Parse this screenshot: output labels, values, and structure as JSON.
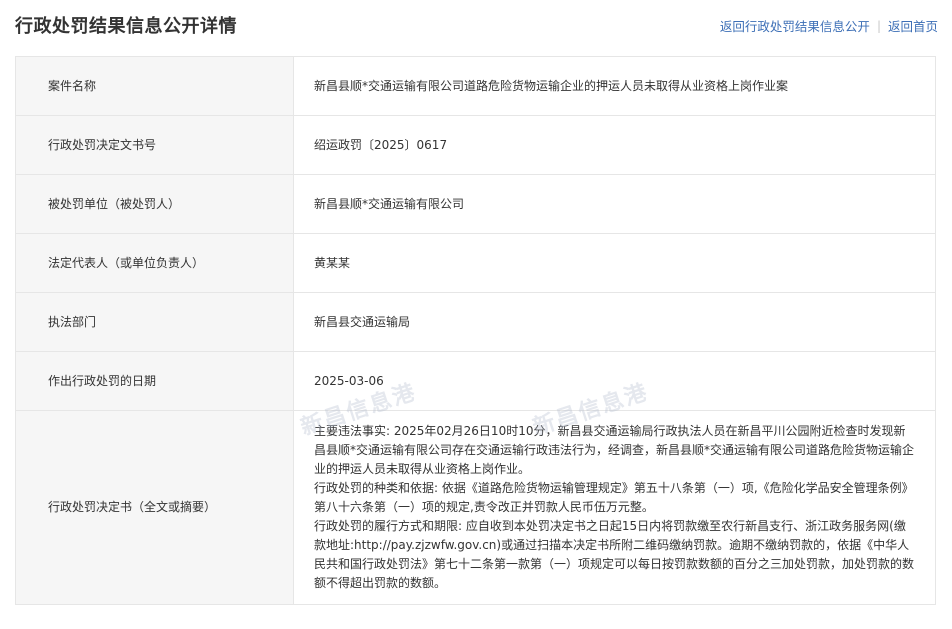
{
  "header": {
    "title": "行政处罚结果信息公开详情",
    "link_back_list": "返回行政处罚结果信息公开",
    "link_home": "返回首页"
  },
  "rows": [
    {
      "label": "案件名称",
      "value": "新昌县顺*交通运输有限公司道路危险货物运输企业的押运人员未取得从业资格上岗作业案"
    },
    {
      "label": "行政处罚决定文书号",
      "value": "绍运政罚〔2025〕0617"
    },
    {
      "label": "被处罚单位（被处罚人）",
      "value": "新昌县顺*交通运输有限公司"
    },
    {
      "label": "法定代表人（或单位负责人）",
      "value": "黄某某"
    },
    {
      "label": "执法部门",
      "value": "新昌县交通运输局"
    },
    {
      "label": "作出行政处罚的日期",
      "value": "2025-03-06"
    }
  ],
  "decision": {
    "label": "行政处罚决定书（全文或摘要）",
    "paragraphs": [
      "主要违法事实: 2025年02月26日10时10分，新昌县交通运输局行政执法人员在新昌平川公园附近检查时发现新昌县顺*交通运输有限公司存在交通运输行政违法行为，经调查，新昌县顺*交通运输有限公司道路危险货物运输企业的押运人员未取得从业资格上岗作业。",
      "行政处罚的种类和依据: 依据《道路危险货物运输管理规定》第五十八条第（一）项,《危险化学品安全管理条例》第八十六条第（一）项的规定,责令改正并罚款人民币伍万元整。",
      "行政处罚的履行方式和期限: 应自收到本处罚决定书之日起15日内将罚款缴至农行新昌支行、浙江政务服务网(缴款地址:http://pay.zjzwfw.gov.cn)或通过扫描本决定书所附二维码缴纳罚款。逾期不缴纳罚款的，依据《中华人民共和国行政处罚法》第七十二条第一款第（一）项规定可以每日按罚款数额的百分之三加处罚款，加处罚款的数额不得超出罚款的数额。"
    ]
  },
  "watermarks": [
    "新昌信息港",
    "新昌信息港"
  ]
}
